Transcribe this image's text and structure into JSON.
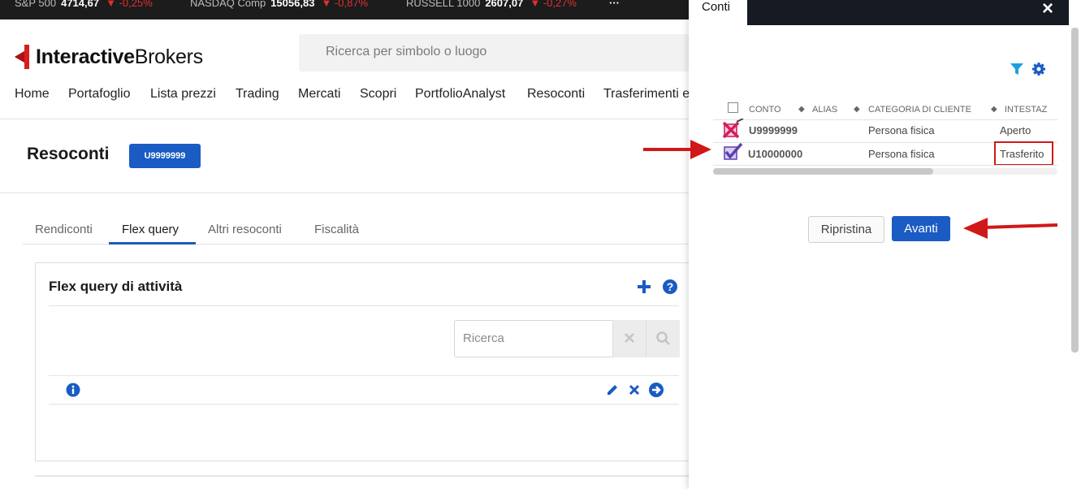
{
  "ticker": [
    {
      "name": "S&P 500",
      "value": "4714,67",
      "change": "▼ -0,25%"
    },
    {
      "name": "NASDAQ Comp",
      "value": "15056,83",
      "change": "▼ -0,87%"
    },
    {
      "name": "RUSSELL 1000",
      "value": "2607,07",
      "change": "▼ -0,27%"
    }
  ],
  "ticker_more": "···",
  "logo": {
    "bold": "Interactive",
    "regular": "Brokers"
  },
  "search": {
    "placeholder": "Ricerca per simbolo o luogo"
  },
  "nav": [
    "Home",
    "Portafoglio",
    "Lista prezzi",
    "Trading",
    "Mercati",
    "Scopri",
    "PortfolioAnalyst",
    "Resoconti",
    "Trasferimenti e"
  ],
  "page": {
    "title": "Resoconti",
    "account_badge": "U9999999"
  },
  "tabs": [
    "Rendiconti",
    "Flex query",
    "Altri resoconti",
    "Fiscalità"
  ],
  "card": {
    "title": "Flex query di attività",
    "search_placeholder": "Ricerca"
  },
  "panel": {
    "tab_label": "Conti",
    "close": "×",
    "columns": [
      "CONTO",
      "ALIAS",
      "CATEGORIA DI CLIENTE",
      "INTESTAZ"
    ],
    "rows": [
      {
        "conto": "U9999999",
        "alias": "",
        "categoria": "Persona fisica",
        "status": "Aperto",
        "checked": false
      },
      {
        "conto": "U10000000",
        "alias": "",
        "categoria": "Persona fisica",
        "status": "Trasferito",
        "checked": true
      }
    ],
    "reset_label": "Ripristina",
    "next_label": "Avanti"
  },
  "colors": {
    "accent": "#1a5bc4",
    "annotation": "#d01818",
    "header_dark": "#161a22"
  }
}
